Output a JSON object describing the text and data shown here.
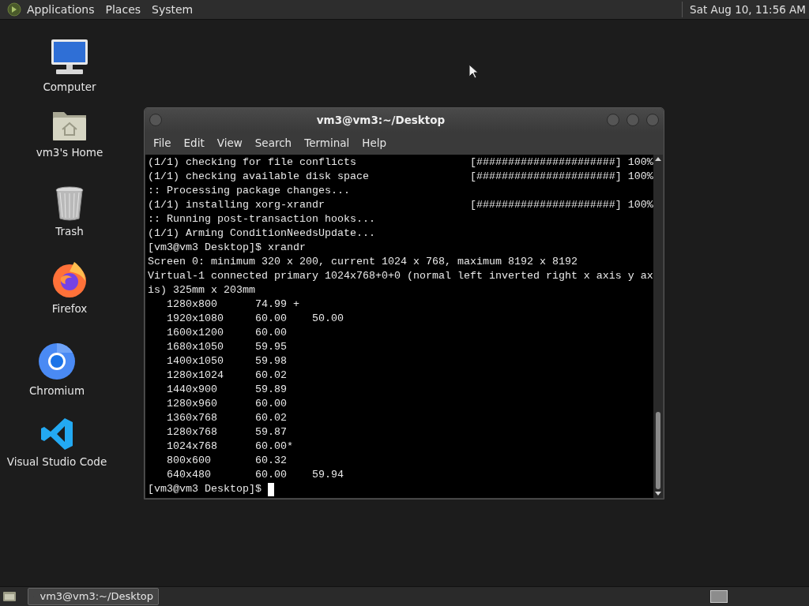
{
  "top_panel": {
    "menus": [
      "Applications",
      "Places",
      "System"
    ],
    "clock": "Sat Aug 10, 11:56 AM"
  },
  "desktop_icons": [
    {
      "kind": "computer",
      "label": "Computer"
    },
    {
      "kind": "home",
      "label": "vm3's Home"
    },
    {
      "kind": "trash",
      "label": "Trash"
    },
    {
      "kind": "firefox",
      "label": "Firefox"
    },
    {
      "kind": "chromium",
      "label": "Chromium"
    },
    {
      "kind": "vscode",
      "label": "Visual Studio Code"
    }
  ],
  "terminal_window": {
    "title": "vm3@vm3:~/Desktop",
    "menu": [
      "File",
      "Edit",
      "View",
      "Search",
      "Terminal",
      "Help"
    ],
    "lines": [
      "(1/1) checking for file conflicts                  [######################] 100%",
      "(1/1) checking available disk space                [######################] 100%",
      ":: Processing package changes...",
      "(1/1) installing xorg-xrandr                       [######################] 100%",
      ":: Running post-transaction hooks...",
      "(1/1) Arming ConditionNeedsUpdate...",
      "[vm3@vm3 Desktop]$ xrandr",
      "Screen 0: minimum 320 x 200, current 1024 x 768, maximum 8192 x 8192",
      "Virtual-1 connected primary 1024x768+0+0 (normal left inverted right x axis y ax",
      "is) 325mm x 203mm",
      "   1280x800      74.99 +",
      "   1920x1080     60.00    50.00",
      "   1600x1200     60.00",
      "   1680x1050     59.95",
      "   1400x1050     59.98",
      "   1280x1024     60.02",
      "   1440x900      59.89",
      "   1280x960      60.00",
      "   1360x768      60.02",
      "   1280x768      59.87",
      "   1024x768      60.00*",
      "   800x600       60.32",
      "   640x480       60.00    59.94"
    ],
    "prompt": "[vm3@vm3 Desktop]$"
  },
  "taskbar": {
    "tasks": [
      {
        "label": "vm3@vm3:~/Desktop",
        "selected": true
      }
    ]
  }
}
